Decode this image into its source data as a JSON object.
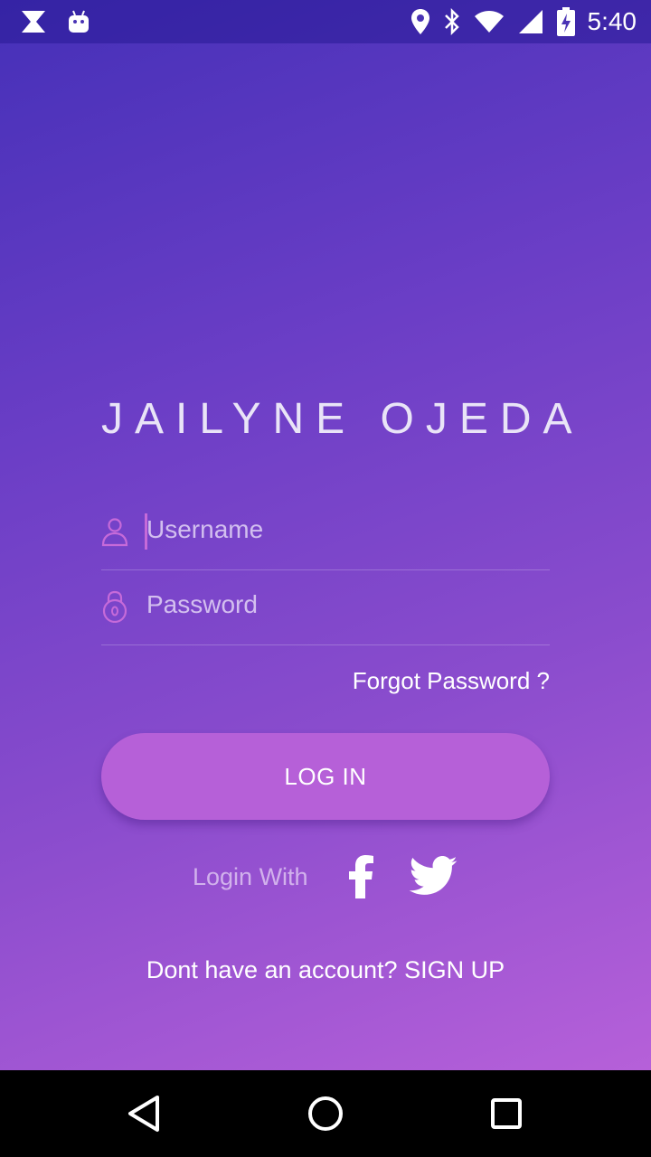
{
  "status_bar": {
    "time": "5:40",
    "left_icons": [
      "x-app-icon",
      "android-debug-icon"
    ],
    "right_icons": [
      "location-icon",
      "bluetooth-icon",
      "wifi-icon",
      "signal-icon",
      "battery-charging-icon"
    ]
  },
  "app": {
    "title": "JAILYNE OJEDA"
  },
  "form": {
    "username_placeholder": "Username",
    "password_placeholder": "Password",
    "forgot_label": "Forgot Password ?",
    "login_label": "LOG IN"
  },
  "social": {
    "login_with_label": "Login With",
    "providers": [
      "facebook-icon",
      "twitter-icon"
    ]
  },
  "signup": {
    "label": "Dont have an account? SIGN UP"
  },
  "navigation": {
    "buttons": [
      "back-icon",
      "home-icon",
      "recents-icon"
    ]
  },
  "colors": {
    "gradient_top": "#4530b8",
    "gradient_bottom": "#b660d9",
    "button": "#b660d8",
    "icon_accent": "#c66ad9"
  }
}
